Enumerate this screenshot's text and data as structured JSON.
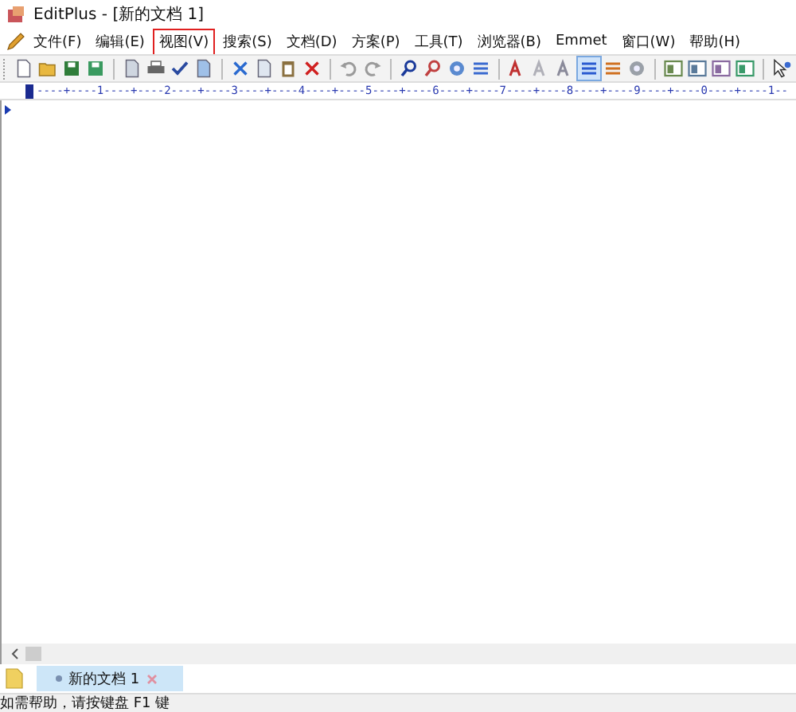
{
  "window": {
    "title": "EditPlus - [新的文档 1]"
  },
  "menu": [
    {
      "label": "文件(F)",
      "highlighted": false
    },
    {
      "label": "编辑(E)",
      "highlighted": false
    },
    {
      "label": "视图(V)",
      "highlighted": true
    },
    {
      "label": "搜索(S)",
      "highlighted": false
    },
    {
      "label": "文档(D)",
      "highlighted": false
    },
    {
      "label": "方案(P)",
      "highlighted": false
    },
    {
      "label": "工具(T)",
      "highlighted": false
    },
    {
      "label": "浏览器(B)",
      "highlighted": false
    },
    {
      "label": "Emmet",
      "highlighted": false
    },
    {
      "label": "窗口(W)",
      "highlighted": false
    },
    {
      "label": "帮助(H)",
      "highlighted": false
    }
  ],
  "ruler": "----+----1----+----2----+----3----+----4----+----5----+----6----+----7----+----8----+----9----+----0----+----1--",
  "tabs": [
    {
      "label": "新的文档 1",
      "selected": true
    }
  ],
  "status_bar": "如需帮助，请按键盘 F1 键"
}
